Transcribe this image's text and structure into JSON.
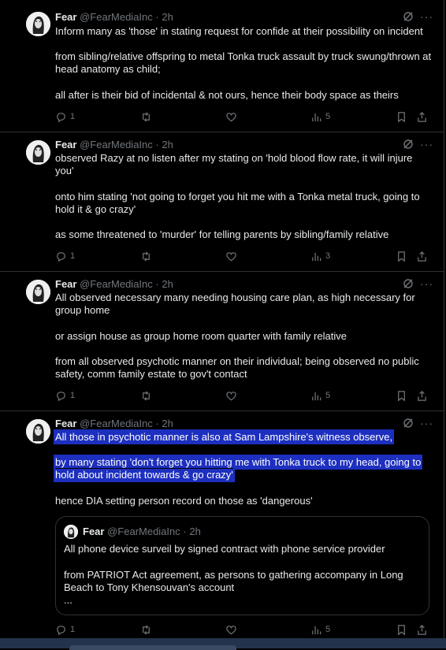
{
  "colors": {
    "background": "#000000",
    "text": "#e7e9ea",
    "muted": "#71767b",
    "border": "#2f3336",
    "highlight": "#1d2fbf"
  },
  "icons": [
    "reply-icon",
    "repost-icon",
    "like-icon",
    "views-icon",
    "bookmark-icon",
    "share-icon",
    "grok-icon",
    "more-icon"
  ],
  "tweets": [
    {
      "author": "Fear",
      "handle": "@FearMediaInc",
      "dot": "·",
      "time": "2h",
      "paragraphs": [
        "Inform many as 'those' in stating request for confide at their possibility on incident",
        "from sibling/relative offspring to metal Tonka truck assault by truck swung/thrown at head anatomy as child;",
        "all after is their bid of incidental & not ours, hence their body space as theirs"
      ],
      "replies": "1",
      "views": "5"
    },
    {
      "author": "Fear",
      "handle": "@FearMediaInc",
      "dot": "·",
      "time": "2h",
      "paragraphs": [
        "observed Razy at no listen after my stating on 'hold blood flow rate, it will injure you'",
        "onto him stating 'not going to forget you hit me with a Tonka metal truck, going to hold it & go crazy'",
        "as some threatened to 'murder' for telling parents by sibling/family relative"
      ],
      "replies": "1",
      "views": "3"
    },
    {
      "author": "Fear",
      "handle": "@FearMediaInc",
      "dot": "·",
      "time": "2h",
      "paragraphs": [
        "All observed necessary many needing housing care plan, as high necessary for group home",
        "or assign house as group home room quarter with family relative",
        "from all observed psychotic manner on their individual; being observed no public safety, comm family estate to gov't contact"
      ],
      "replies": "1",
      "views": "5"
    },
    {
      "author": "Fear",
      "handle": "@FearMediaInc",
      "dot": "·",
      "time": "2h",
      "paragraphs": [
        "All those in psychotic manner is also at Sam Lampshire's witness observe,",
        "by many stating 'don't forget you hitting me with Tonka truck to my head, going to hold about incident towards & go crazy'",
        "hence DIA setting person record on those as 'dangerous'"
      ],
      "quote": {
        "author": "Fear",
        "handle": "@FearMediaInc",
        "dot": "·",
        "time": "2h",
        "paragraphs": [
          "All phone device surveil by signed contract with phone service provider",
          "from PATRIOT Act agreement, as persons to gathering accompany in Long Beach to Tony Khensouvan's account",
          "..."
        ]
      },
      "replies": "1",
      "views": "5"
    }
  ]
}
